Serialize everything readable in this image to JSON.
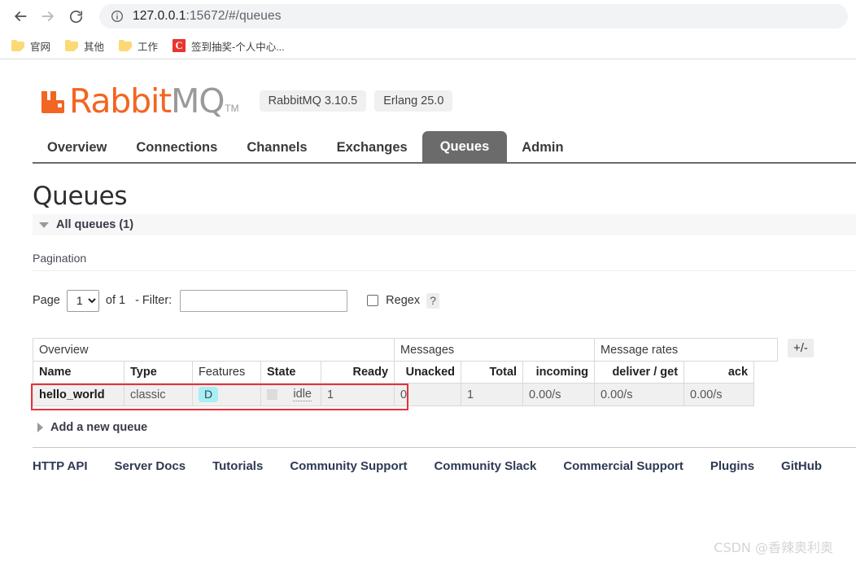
{
  "browser": {
    "back_icon": "back-arrow-icon",
    "forward_icon": "forward-arrow-icon",
    "reload_icon": "reload-icon",
    "info_icon": "site-info-icon",
    "url_host": "127.0.0.1",
    "url_path": ":15672/#/queues",
    "url_full": "127.0.0.1:15672/#/queues",
    "bookmarks": [
      {
        "label": "官网",
        "icon": "folder-icon"
      },
      {
        "label": "其他",
        "icon": "folder-icon"
      },
      {
        "label": "工作",
        "icon": "folder-icon"
      },
      {
        "label": "签到抽奖-个人中心...",
        "icon": "csdn-favicon"
      }
    ]
  },
  "header": {
    "logo_rabbit": "Rabbit",
    "logo_mq": "MQ",
    "logo_tm": "TM",
    "logo_icon": "rabbitmq-logo-icon",
    "badges": [
      {
        "label": "RabbitMQ 3.10.5"
      },
      {
        "label": "Erlang 25.0"
      }
    ]
  },
  "nav": {
    "tabs": [
      {
        "label": "Overview",
        "active": false
      },
      {
        "label": "Connections",
        "active": false
      },
      {
        "label": "Channels",
        "active": false
      },
      {
        "label": "Exchanges",
        "active": false
      },
      {
        "label": "Queues",
        "active": true
      },
      {
        "label": "Admin",
        "active": false
      }
    ]
  },
  "main": {
    "page_title": "Queues",
    "section_title": "All queues (1)",
    "pagination_label": "Pagination",
    "page_text": "Page",
    "page_value": "1",
    "page_options": [
      "1"
    ],
    "of_text": "of 1",
    "filter_label": "- Filter:",
    "filter_value": "",
    "filter_placeholder": "",
    "regex_label": "Regex",
    "regex_checked": false,
    "help_label": "?",
    "plus_minus_label": "+/-",
    "add_queue_label": "Add a new queue"
  },
  "table": {
    "group_headers": [
      {
        "label": "Overview",
        "span": 5
      },
      {
        "label": "Messages",
        "span": 3
      },
      {
        "label": "Message rates",
        "span": 3
      }
    ],
    "columns": [
      {
        "label": "Name",
        "sortable": true,
        "align": "left"
      },
      {
        "label": "Type",
        "sortable": true,
        "align": "left"
      },
      {
        "label": "Features",
        "sortable": false,
        "align": "center"
      },
      {
        "label": "State",
        "sortable": true,
        "align": "left"
      },
      {
        "label": "Ready",
        "sortable": true,
        "align": "right"
      },
      {
        "label": "Unacked",
        "sortable": true,
        "align": "right"
      },
      {
        "label": "Total",
        "sortable": true,
        "align": "right"
      },
      {
        "label": "incoming",
        "sortable": true,
        "align": "right"
      },
      {
        "label": "deliver / get",
        "sortable": true,
        "align": "right"
      },
      {
        "label": "ack",
        "sortable": true,
        "align": "right"
      }
    ],
    "rows": [
      {
        "name": "hello_world",
        "type": "classic",
        "features": "D",
        "state": "idle",
        "ready": "1",
        "unacked": "0",
        "total": "1",
        "incoming": "0.00/s",
        "deliver_get": "0.00/s",
        "ack": "0.00/s"
      }
    ]
  },
  "footer": {
    "links": [
      {
        "label": "HTTP API"
      },
      {
        "label": "Server Docs"
      },
      {
        "label": "Tutorials"
      },
      {
        "label": "Community Support"
      },
      {
        "label": "Community Slack"
      },
      {
        "label": "Commercial Support"
      },
      {
        "label": "Plugins"
      },
      {
        "label": "GitHub"
      }
    ]
  },
  "watermark": {
    "text": "CSDN @香辣奥利奥"
  },
  "colors": {
    "brand_orange": "#f26522",
    "active_tab": "#6b6b6b",
    "feature_badge": "#a8eef5",
    "highlight_red": "#e8323c"
  }
}
